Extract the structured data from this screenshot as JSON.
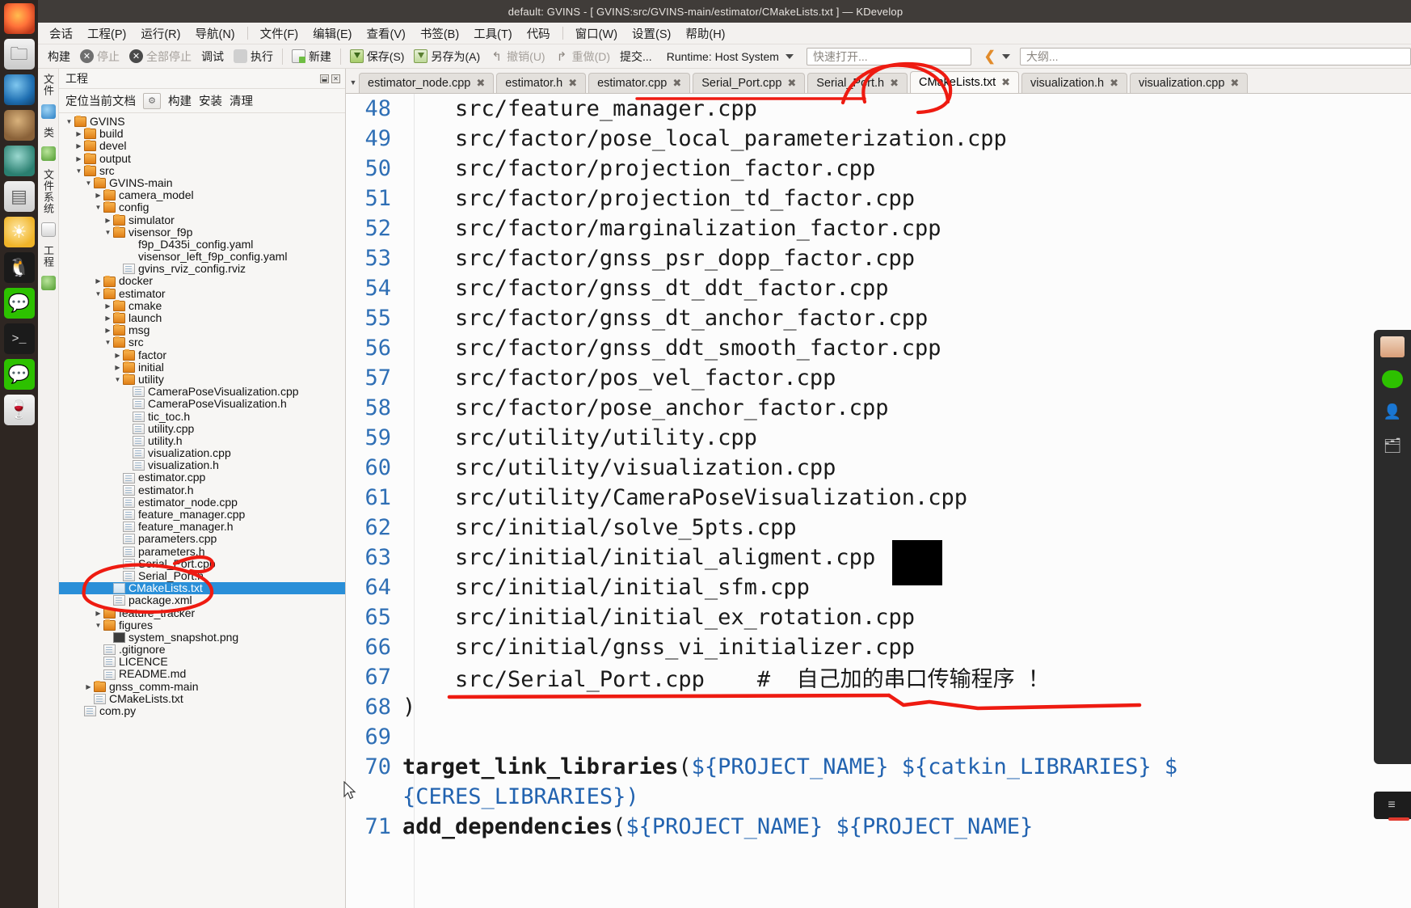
{
  "window": {
    "title": "default:  GVINS - [ GVINS:src/GVINS-main/estimator/CMakeLists.txt ] — KDevelop"
  },
  "menubar": {
    "items": [
      {
        "label": "会话"
      },
      {
        "label": "工程(P)"
      },
      {
        "label": "运行(R)"
      },
      {
        "label": "导航(N)"
      },
      {
        "sep": true
      },
      {
        "label": "文件(F)"
      },
      {
        "label": "编辑(E)"
      },
      {
        "label": "查看(V)"
      },
      {
        "label": "书签(B)"
      },
      {
        "label": "工具(T)"
      },
      {
        "label": "代码"
      },
      {
        "sep": true
      },
      {
        "label": "窗口(W)"
      },
      {
        "label": "设置(S)"
      },
      {
        "label": "帮助(H)"
      }
    ]
  },
  "toolbar": {
    "build": "构建",
    "stop": "停止",
    "stop_all": "全部停止",
    "debug": "调试",
    "execute": "执行",
    "new": "新建",
    "save": "保存(S)",
    "save_as": "另存为(A)",
    "undo": "撤销(U)",
    "redo": "重做(D)",
    "commit": "提交...",
    "runtime": "Runtime: Host System",
    "quick_open_placeholder": "快速打开...",
    "outline_placeholder": "大纲..."
  },
  "left_dock": {
    "tabs": [
      "文件",
      "类",
      "文件系统",
      "工程"
    ],
    "launcher_icons": [
      "firefox-icon",
      "files-icon",
      "web-browser-icon",
      "gimp-icon",
      "settings-icon",
      "office-icon",
      "brightness-icon",
      "tux-icon",
      "wechat-icon",
      "terminal-icon",
      "wechat2-icon",
      "wine-icon"
    ]
  },
  "project_panel": {
    "header": "工程",
    "actions": [
      "定位当前文档",
      "构建",
      "安装",
      "清理"
    ],
    "tree": [
      {
        "depth": 0,
        "arrow": "open",
        "icon": "folder",
        "label": "GVINS"
      },
      {
        "depth": 1,
        "arrow": "closed",
        "icon": "folder",
        "label": "build"
      },
      {
        "depth": 1,
        "arrow": "closed",
        "icon": "folder",
        "label": "devel"
      },
      {
        "depth": 1,
        "arrow": "closed",
        "icon": "folder",
        "label": "output"
      },
      {
        "depth": 1,
        "arrow": "open",
        "icon": "folder",
        "label": "src"
      },
      {
        "depth": 2,
        "arrow": "open",
        "icon": "folder",
        "label": "GVINS-main"
      },
      {
        "depth": 3,
        "arrow": "closed",
        "icon": "folder",
        "label": "camera_model"
      },
      {
        "depth": 3,
        "arrow": "open",
        "icon": "folder",
        "label": "config"
      },
      {
        "depth": 4,
        "arrow": "closed",
        "icon": "folder",
        "label": "simulator"
      },
      {
        "depth": 4,
        "arrow": "open",
        "icon": "folder",
        "label": "visensor_f9p"
      },
      {
        "depth": 5,
        "arrow": "none",
        "icon": "none",
        "label": "f9p_D435i_config.yaml"
      },
      {
        "depth": 5,
        "arrow": "none",
        "icon": "none",
        "label": "visensor_left_f9p_config.yaml"
      },
      {
        "depth": 5,
        "arrow": "none",
        "icon": "file",
        "label": "gvins_rviz_config.rviz"
      },
      {
        "depth": 3,
        "arrow": "closed",
        "icon": "folder",
        "label": "docker"
      },
      {
        "depth": 3,
        "arrow": "open",
        "icon": "folder",
        "label": "estimator"
      },
      {
        "depth": 4,
        "arrow": "closed",
        "icon": "folder",
        "label": "cmake"
      },
      {
        "depth": 4,
        "arrow": "closed",
        "icon": "folder",
        "label": "launch"
      },
      {
        "depth": 4,
        "arrow": "closed",
        "icon": "folder",
        "label": "msg"
      },
      {
        "depth": 4,
        "arrow": "open",
        "icon": "folder",
        "label": "src"
      },
      {
        "depth": 5,
        "arrow": "closed",
        "icon": "folder",
        "label": "factor"
      },
      {
        "depth": 5,
        "arrow": "closed",
        "icon": "folder",
        "label": "initial"
      },
      {
        "depth": 5,
        "arrow": "open",
        "icon": "folder",
        "label": "utility"
      },
      {
        "depth": 6,
        "arrow": "none",
        "icon": "file",
        "label": "CameraPoseVisualization.cpp"
      },
      {
        "depth": 6,
        "arrow": "none",
        "icon": "file",
        "label": "CameraPoseVisualization.h"
      },
      {
        "depth": 6,
        "arrow": "none",
        "icon": "file",
        "label": "tic_toc.h"
      },
      {
        "depth": 6,
        "arrow": "none",
        "icon": "file",
        "label": "utility.cpp"
      },
      {
        "depth": 6,
        "arrow": "none",
        "icon": "file",
        "label": "utility.h"
      },
      {
        "depth": 6,
        "arrow": "none",
        "icon": "file",
        "label": "visualization.cpp"
      },
      {
        "depth": 6,
        "arrow": "none",
        "icon": "file",
        "label": "visualization.h"
      },
      {
        "depth": 5,
        "arrow": "none",
        "icon": "file",
        "label": "estimator.cpp"
      },
      {
        "depth": 5,
        "arrow": "none",
        "icon": "file",
        "label": "estimator.h"
      },
      {
        "depth": 5,
        "arrow": "none",
        "icon": "file",
        "label": "estimator_node.cpp"
      },
      {
        "depth": 5,
        "arrow": "none",
        "icon": "file",
        "label": "feature_manager.cpp"
      },
      {
        "depth": 5,
        "arrow": "none",
        "icon": "file",
        "label": "feature_manager.h"
      },
      {
        "depth": 5,
        "arrow": "none",
        "icon": "file",
        "label": "parameters.cpp"
      },
      {
        "depth": 5,
        "arrow": "none",
        "icon": "file",
        "label": "parameters.h"
      },
      {
        "depth": 5,
        "arrow": "none",
        "icon": "file",
        "label": "Serial_Port.cpp"
      },
      {
        "depth": 5,
        "arrow": "none",
        "icon": "file",
        "label": "Serial_Port.h"
      },
      {
        "depth": 4,
        "arrow": "none",
        "icon": "txt",
        "label": "CMakeLists.txt",
        "selected": true
      },
      {
        "depth": 4,
        "arrow": "none",
        "icon": "file",
        "label": "package.xml"
      },
      {
        "depth": 3,
        "arrow": "closed",
        "icon": "folder",
        "label": "feature_tracker"
      },
      {
        "depth": 3,
        "arrow": "open",
        "icon": "folder",
        "label": "figures"
      },
      {
        "depth": 4,
        "arrow": "none",
        "icon": "img",
        "label": "system_snapshot.png"
      },
      {
        "depth": 3,
        "arrow": "none",
        "icon": "file",
        "label": ".gitignore"
      },
      {
        "depth": 3,
        "arrow": "none",
        "icon": "file",
        "label": "LICENCE"
      },
      {
        "depth": 3,
        "arrow": "none",
        "icon": "file",
        "label": "README.md"
      },
      {
        "depth": 2,
        "arrow": "closed",
        "icon": "folder",
        "label": "gnss_comm-main"
      },
      {
        "depth": 2,
        "arrow": "none",
        "icon": "file",
        "label": "CMakeLists.txt"
      },
      {
        "depth": 1,
        "arrow": "none",
        "icon": "file",
        "label": "com.py"
      }
    ]
  },
  "editor": {
    "tabs": [
      {
        "label": "estimator_node.cpp",
        "active": false
      },
      {
        "label": "estimator.h",
        "active": false
      },
      {
        "label": "estimator.cpp",
        "active": false
      },
      {
        "label": "Serial_Port.cpp",
        "active": false
      },
      {
        "label": "Serial_Port.h",
        "active": false
      },
      {
        "label": "CMakeLists.txt",
        "active": true
      },
      {
        "label": "visualization.h",
        "active": false
      },
      {
        "label": "visualization.cpp",
        "active": false
      }
    ],
    "close_glyph": "✖",
    "lines": [
      {
        "num": "48",
        "text": "    src/feature_manager.cpp"
      },
      {
        "num": "49",
        "text": "    src/factor/pose_local_parameterization.cpp"
      },
      {
        "num": "50",
        "text": "    src/factor/projection_factor.cpp"
      },
      {
        "num": "51",
        "text": "    src/factor/projection_td_factor.cpp"
      },
      {
        "num": "52",
        "text": "    src/factor/marginalization_factor.cpp"
      },
      {
        "num": "53",
        "text": "    src/factor/gnss_psr_dopp_factor.cpp"
      },
      {
        "num": "54",
        "text": "    src/factor/gnss_dt_ddt_factor.cpp"
      },
      {
        "num": "55",
        "text": "    src/factor/gnss_dt_anchor_factor.cpp"
      },
      {
        "num": "56",
        "text": "    src/factor/gnss_ddt_smooth_factor.cpp"
      },
      {
        "num": "57",
        "text": "    src/factor/pos_vel_factor.cpp"
      },
      {
        "num": "58",
        "text": "    src/factor/pose_anchor_factor.cpp"
      },
      {
        "num": "59",
        "text": "    src/utility/utility.cpp"
      },
      {
        "num": "60",
        "text": "    src/utility/visualization.cpp"
      },
      {
        "num": "61",
        "text": "    src/utility/CameraPoseVisualization.cpp"
      },
      {
        "num": "62",
        "text": "    src/initial/solve_5pts.cpp"
      },
      {
        "num": "63",
        "text": "    src/initial/initial_aligment.cpp"
      },
      {
        "num": "64",
        "text": "    src/initial/initial_sfm.cpp"
      },
      {
        "num": "65",
        "text": "    src/initial/initial_ex_rotation.cpp"
      },
      {
        "num": "66",
        "text": "    src/initial/gnss_vi_initializer.cpp"
      },
      {
        "num": "67",
        "text": "    src/Serial_Port.cpp    #  自己加的串口传输程序 ！",
        "annotated": true
      },
      {
        "num": "68",
        "text": ")"
      },
      {
        "num": "69",
        "text": ""
      },
      {
        "num": "70",
        "text": "target_link_libraries(${PROJECT_NAME} ${catkin_LIBRARIES} $",
        "kind": "call"
      },
      {
        "num": "",
        "text": "{CERES_LIBRARIES})",
        "kind": "cont"
      },
      {
        "num": "71",
        "text": "add_dependencies(${PROJECT_NAME} ${PROJECT_NAME}",
        "kind": "call-clipped"
      }
    ]
  },
  "annotations": {
    "tab_circle": "red-ellipse-around-cmakelists-tab",
    "quick_open_arc": "red-arc-over-quick-open",
    "tree_circle": "red-ellipse-around-cmakelists-tree-item",
    "tree_swoosh": "red-stroke-near-serial-port-cpp",
    "line67_underline": "red-underline-under-line-67",
    "line67_pointer": "red-pointer-line-to-right"
  },
  "colors": {
    "accent_selection": "#2a8fd8",
    "annotation_red": "#ee1b11",
    "line_number": "#2f6fb5",
    "code_variable": "#2263b0",
    "titlebar_bg": "#403c39",
    "chrome_bg": "#f3f1ef"
  }
}
